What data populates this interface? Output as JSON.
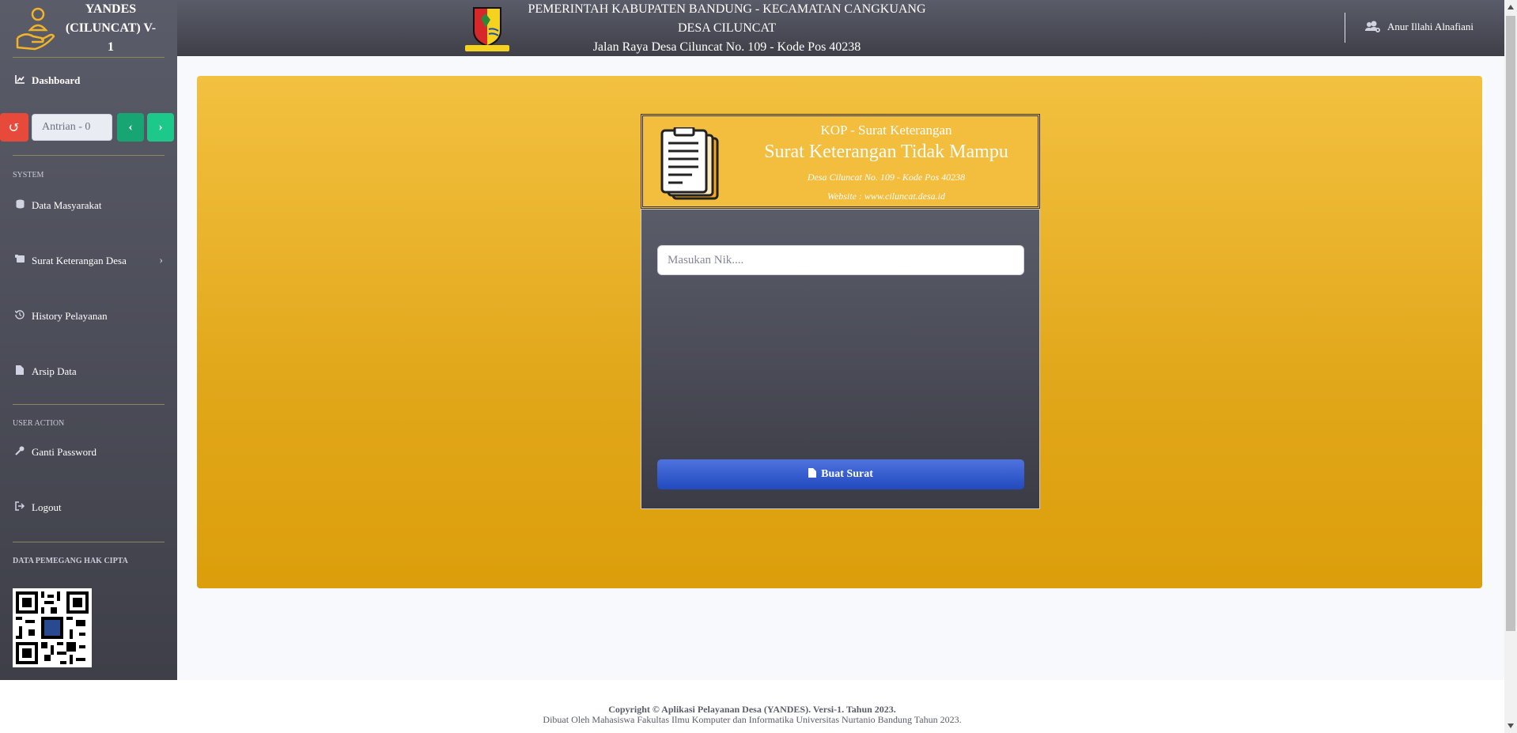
{
  "brand": {
    "title": "YANDES (CILUNCAT) V-1"
  },
  "sidebar": {
    "dashboard": "Dashboard",
    "queue": {
      "value": "Antrian - 0"
    },
    "section_system": "SYSTEM",
    "items": [
      {
        "label": "Data Masyarakat"
      },
      {
        "label": "Surat Keterangan Desa"
      },
      {
        "label": "History Pelayanan"
      },
      {
        "label": "Arsip Data"
      }
    ],
    "section_user": "USER ACTION",
    "user_items": [
      {
        "label": "Ganti Password"
      },
      {
        "label": "Logout"
      }
    ],
    "section_copyright": "DATA PEMEGANG HAK CIPTA"
  },
  "header": {
    "line1": "PEMERINTAH KABUPATEN BANDUNG - KECAMATAN CANGKUANG",
    "line2": "DESA CILUNCAT",
    "line3": "Jalan Raya Desa Ciluncat No. 109 - Kode Pos 40238",
    "user_name": "Anur Illahi Alnafiani"
  },
  "kop": {
    "line1": "KOP - Surat Keterangan",
    "title": "Surat Keterangan Tidak Mampu",
    "address": "Desa Ciluncat No. 109 - Kode Pos 40238",
    "website": "Website : www.ciluncat.desa.id"
  },
  "form": {
    "nik_placeholder": "Masukan Nik....",
    "nik_value": "",
    "submit_label": "Buat Surat"
  },
  "footer": {
    "line1": "Copyright © Aplikasi Pelayanan Desa (YANDES). Versi-1. Tahun 2023.",
    "line2": "Dibuat Oleh Mahasiswa Fakultas Ilmu Komputer dan Informatika Universitas Nurtanio Bandung Tahun 2023."
  },
  "colors": {
    "accent_gold": "#e1a71a",
    "sidebar_dark": "#3e3f48",
    "primary_blue": "#4e73df",
    "success_green": "#1cc88a",
    "danger_red": "#e74a3b"
  },
  "icons": {
    "brand": "hand-holding-user-icon",
    "dashboard": "chart-line-icon",
    "reset": "undo-icon",
    "prev": "chevron-left-icon",
    "next": "chevron-right-icon",
    "data_masyarakat": "database-icon",
    "surat": "scroll-icon",
    "history": "history-icon",
    "arsip": "file-icon",
    "password": "key-icon",
    "logout": "sign-out-icon",
    "user": "users-cog-icon",
    "kop": "clipboard-document-icon"
  }
}
